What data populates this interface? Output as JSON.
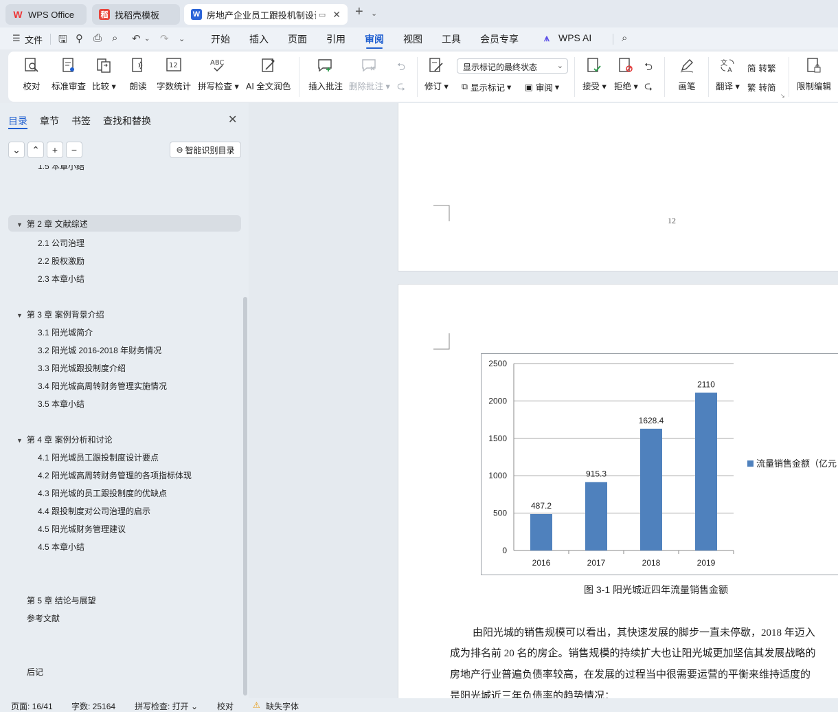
{
  "tabs": [
    {
      "label": "WPS Office",
      "icon": "wps-logo-icon"
    },
    {
      "label": "找稻壳模板",
      "icon": "docer-icon"
    },
    {
      "label": "房地产企业员工跟投机制设计-",
      "icon": "word-doc-icon"
    }
  ],
  "menu": {
    "file": "文件",
    "items": [
      "开始",
      "插入",
      "页面",
      "引用",
      "审阅",
      "视图",
      "工具",
      "会员专享"
    ],
    "active": "审阅",
    "ai": "WPS AI"
  },
  "ribbon": {
    "proofread": "校对",
    "standard_review": "标准审查",
    "compare": "比较",
    "read_aloud": "朗读",
    "word_count": "字数统计",
    "spell_check": "拼写检查",
    "ai_polish": "AI 全文润色",
    "insert_comment": "插入批注",
    "delete_comment": "删除批注",
    "track_changes": "修订",
    "markup_state": "显示标记的最终状态",
    "show_markup": "显示标记",
    "review": "审阅",
    "accept": "接受",
    "reject": "拒绝",
    "pen": "画笔",
    "translate": "翻译",
    "to_traditional": "转繁",
    "to_simplified": "转简",
    "restrict_edit": "限制编辑"
  },
  "nav": {
    "tabs": [
      "目录",
      "章节",
      "书签",
      "查找和替换"
    ],
    "smart_toc": "智能识别目录",
    "toc": [
      {
        "text": "1.5  本章小结",
        "level": 2
      },
      {
        "text": "第 2 章  文献综述",
        "level": 1,
        "selected": true
      },
      {
        "text": "2.1  公司治理",
        "level": 2
      },
      {
        "text": "2.2  股权激励",
        "level": 2
      },
      {
        "text": "2.3  本章小结",
        "level": 2
      },
      {
        "text": "第 3 章  案例背景介绍",
        "level": 1
      },
      {
        "text": "3.1  阳光城简介",
        "level": 2
      },
      {
        "text": "3.2  阳光城 2016-2018 年财务情况",
        "level": 2
      },
      {
        "text": "3.3  阳光城跟投制度介绍",
        "level": 2
      },
      {
        "text": "3.4  阳光城高周转财务管理实施情况",
        "level": 2
      },
      {
        "text": "3.5  本章小结",
        "level": 2
      },
      {
        "text": "第 4 章  案例分析和讨论",
        "level": 1
      },
      {
        "text": "4.1  阳光城员工跟投制度设计要点",
        "level": 2
      },
      {
        "text": "4.2  阳光城高周转财务管理的各项指标体现",
        "level": 2
      },
      {
        "text": "4.3  阳光城的员工跟投制度的优缺点",
        "level": 2
      },
      {
        "text": "4.4  跟投制度对公司治理的启示",
        "level": 2
      },
      {
        "text": "4.5  阳光城财务管理建议",
        "level": 2
      },
      {
        "text": "4.5  本章小结",
        "level": 2
      },
      {
        "text": "第 5 章  结论与展望",
        "level": 1
      },
      {
        "text": "参考文献",
        "level": 1
      },
      {
        "text": "后记",
        "level": 1
      }
    ]
  },
  "document": {
    "page_number": "12",
    "caption": "图 3-1    阳光城近四年流量销售金额",
    "paragraph": [
      "由阳光城的销售规模可以看出，其快速发展的脚步一直未停歇，2018 年迈入",
      "成为排名前 20 名的房企。销售规模的持续扩大也让阳光城更加坚信其发展战略的",
      "房地产行业普遍负债率较高，在发展的过程当中很需要运营的平衡来维持适度的",
      "是阳光城近三年负债率的趋势情况："
    ]
  },
  "chart_data": {
    "type": "bar",
    "categories": [
      "2016",
      "2017",
      "2018",
      "2019"
    ],
    "series": [
      {
        "name": "流量销售金额（亿元",
        "values": [
          487.2,
          915.3,
          1628.4,
          2110
        ],
        "color": "#4f81bd"
      }
    ],
    "data_labels": [
      "487.2",
      "915.3",
      "1628.4",
      "2110"
    ],
    "yticks": [
      "0",
      "500",
      "1000",
      "1500",
      "2000",
      "2500"
    ],
    "ylim": [
      0,
      2500
    ],
    "grid": true,
    "legend_position": "right"
  },
  "status": {
    "page": "页面: 16/41",
    "words": "字数: 25164",
    "spell": "拼写检查: 打开",
    "proof": "校对",
    "missing_font": "缺失字体"
  }
}
